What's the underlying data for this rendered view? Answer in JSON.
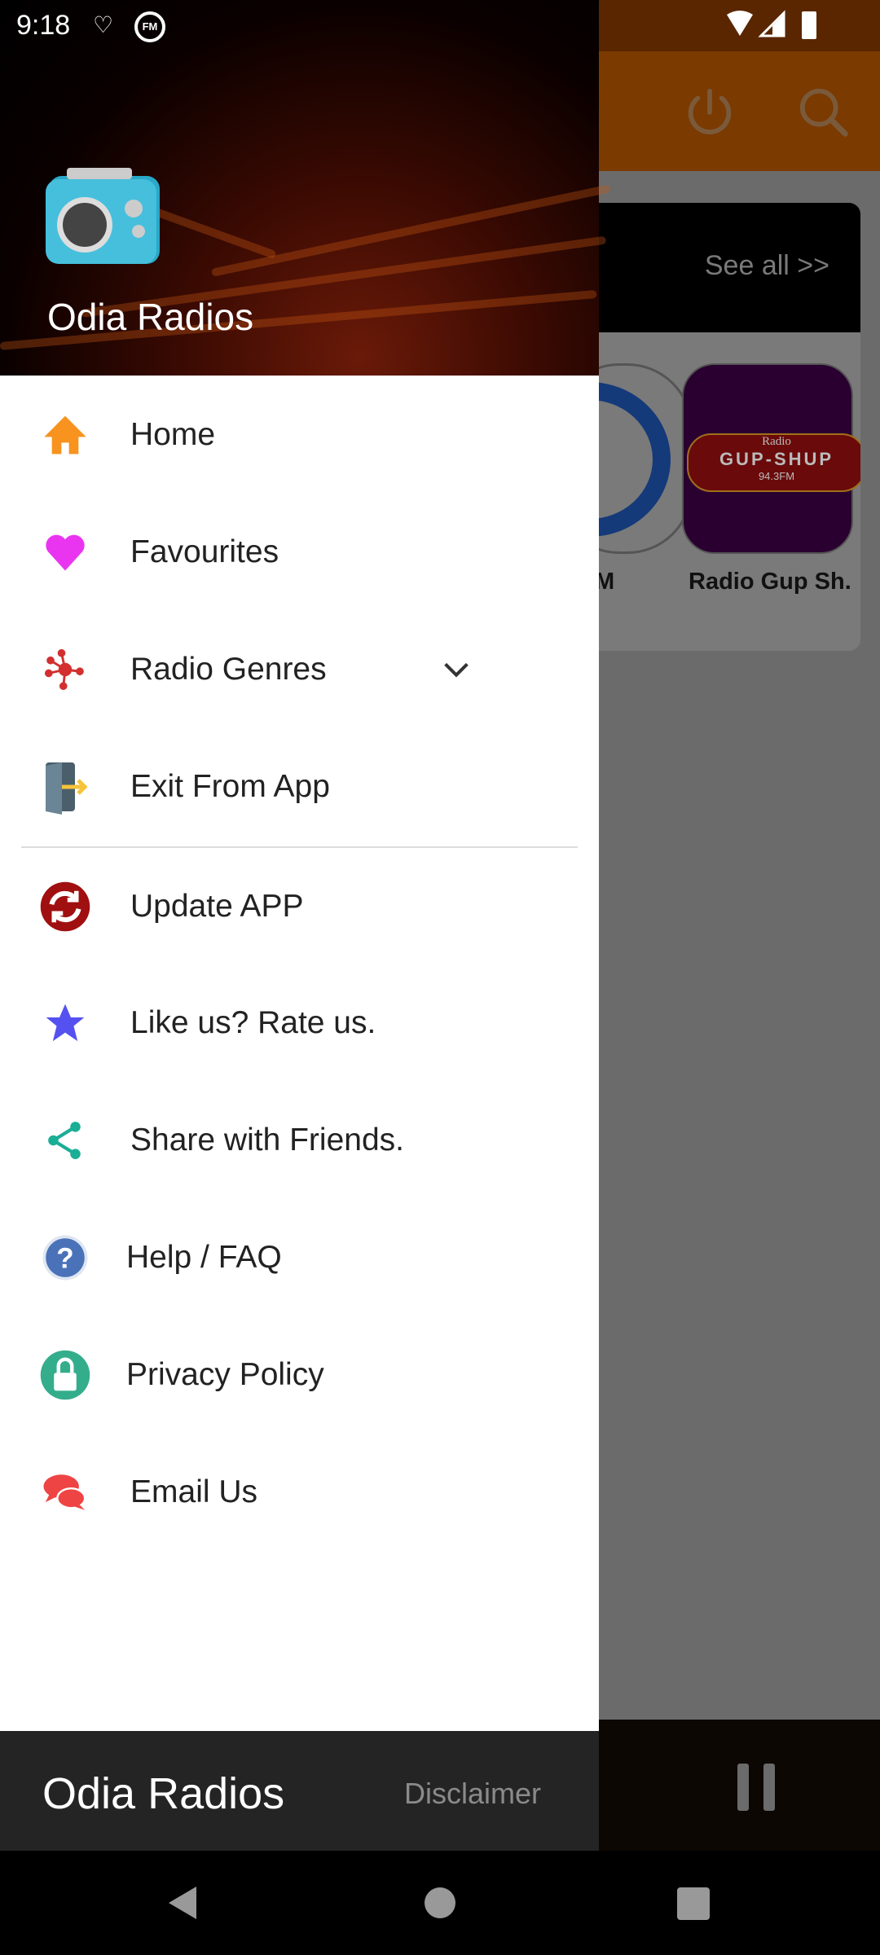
{
  "status_bar": {
    "time": "9:18",
    "left_icons": [
      "notification-icon",
      "fm-icon"
    ],
    "right_icons": [
      "wifi-icon",
      "signal-icon",
      "battery-icon"
    ]
  },
  "background": {
    "toolbar_icons": [
      "power-icon",
      "search-icon"
    ],
    "section_link": "See all >>",
    "stations": [
      {
        "name": "M"
      },
      {
        "name": "Radio Gup Sh.",
        "logo_text": [
          "Radio",
          "GUP-SHUP",
          "94.3FM"
        ]
      }
    ],
    "player_icon": "pause-icon"
  },
  "drawer": {
    "app_title": "Odia Radios",
    "items": [
      {
        "label": "Home",
        "icon": "home-icon",
        "color": "#F7931E"
      },
      {
        "label": "Favourites",
        "icon": "heart-icon",
        "color": "#E935F0"
      },
      {
        "label": "Radio Genres",
        "icon": "genres-icon",
        "color": "#D32F2F",
        "expandable": true
      },
      {
        "label": "Exit From App",
        "icon": "exit-door-icon",
        "color": "#5D7B8C"
      },
      {
        "label": "Update APP",
        "icon": "update-icon",
        "color": "#A01010"
      },
      {
        "label": "Like us? Rate us.",
        "icon": "star-icon",
        "color": "#5551F0"
      },
      {
        "label": "Share with Friends.",
        "icon": "share-icon",
        "color": "#1AAE95"
      },
      {
        "label": "Help / FAQ",
        "icon": "help-icon",
        "color": "#4A72B8"
      },
      {
        "label": "Privacy Policy",
        "icon": "lock-icon",
        "color": "#34AD8C"
      },
      {
        "label": "Email Us",
        "icon": "chat-icon",
        "color": "#EF4444"
      }
    ],
    "footer": {
      "title": "Odia Radios",
      "disclaimer": "Disclaimer"
    }
  }
}
